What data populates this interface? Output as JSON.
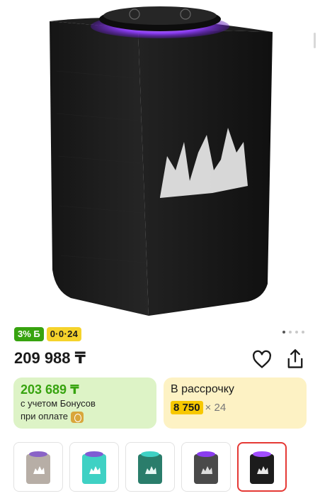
{
  "product": {
    "image": "smart-speaker-black",
    "colors": {
      "body": "#1c1c1c",
      "ring": "#a14dff"
    }
  },
  "badges": {
    "bonus": "3% Б",
    "installment": "0·0·24"
  },
  "gallery": {
    "dots_count": 4,
    "active_dot": 0
  },
  "price": {
    "main": "209 988 ₸"
  },
  "bonus_card": {
    "price": "203 689 ₸",
    "line1": "с учетом Бонусов",
    "line2": "при оплате"
  },
  "installment_card": {
    "title": "В рассрочку",
    "amount": "8 750",
    "multiplier": "× 24"
  },
  "variants": [
    {
      "name": "beige",
      "color": "#b7aea6"
    },
    {
      "name": "turquoise",
      "color": "#3fd1c4"
    },
    {
      "name": "green",
      "color": "#2a7d6b"
    },
    {
      "name": "graphite",
      "color": "#4a4a4a"
    },
    {
      "name": "black",
      "color": "#1c1c1c",
      "selected": true
    }
  ]
}
